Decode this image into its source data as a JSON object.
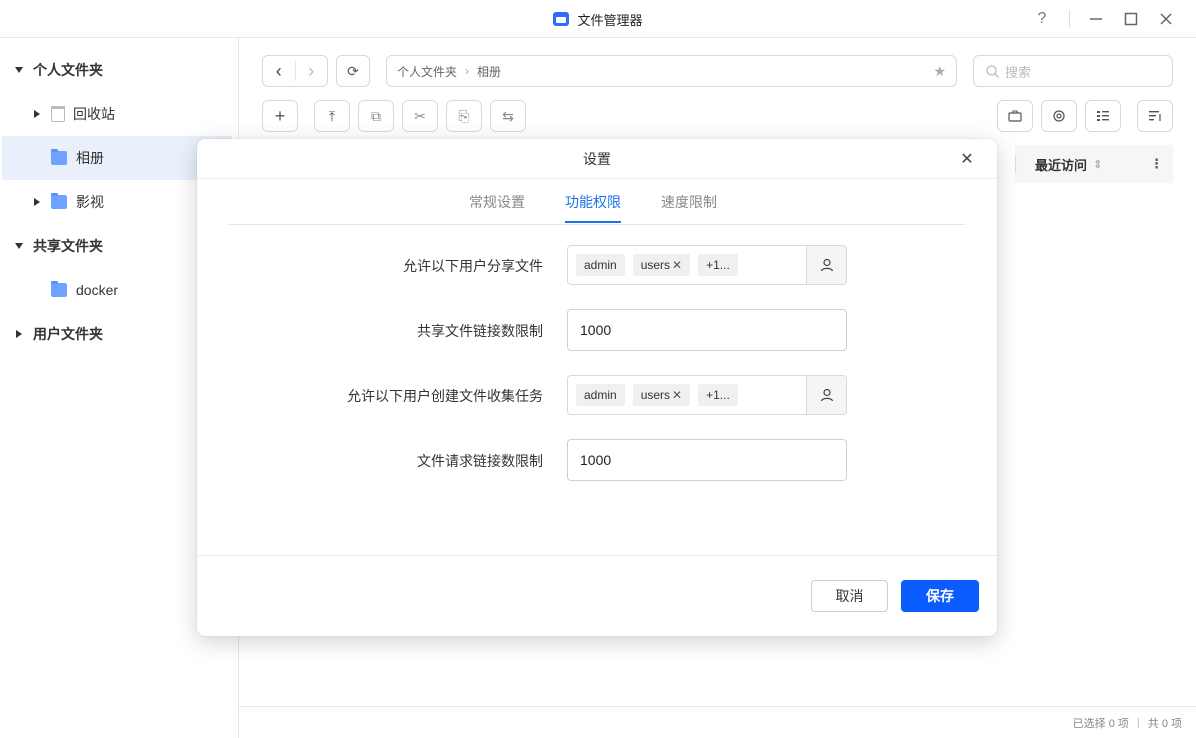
{
  "window": {
    "title": "文件管理器",
    "help": "?",
    "minimize": "—",
    "maximize": "☐",
    "close": "✕"
  },
  "sidebar": {
    "items": [
      {
        "label": "个人文件夹"
      },
      {
        "label": "回收站"
      },
      {
        "label": "相册"
      },
      {
        "label": "影视"
      },
      {
        "label": "共享文件夹"
      },
      {
        "label": "docker"
      },
      {
        "label": "用户文件夹"
      }
    ]
  },
  "toolbar": {
    "back": "‹",
    "forward": "›",
    "refresh": "⟳",
    "breadcrumb": [
      "个人文件夹",
      "相册"
    ],
    "breadcrumb_sep": "›",
    "star": "★",
    "search_placeholder": "搜索",
    "new": "+",
    "upload": "⤒",
    "copy": "⧉",
    "cut": "✂",
    "paste": "⎘",
    "move": "⇆"
  },
  "column": {
    "header": "最近访问",
    "sort": "⇕",
    "more": "⋮"
  },
  "status": {
    "selected": "已选择 0 项",
    "sep": "|",
    "total": "共 0 项"
  },
  "dialog": {
    "title": "设置",
    "close": "✕",
    "tabs": [
      "常规设置",
      "功能权限",
      "速度限制"
    ],
    "active_tab": "功能权限",
    "fields": [
      {
        "label": "允许以下用户分享文件",
        "chips": [
          "admin",
          "users",
          "+1..."
        ]
      },
      {
        "label": "共享文件链接数限制",
        "value": "1000"
      },
      {
        "label": "允许以下用户创建文件收集任务",
        "chips": [
          "admin",
          "users",
          "+1..."
        ]
      },
      {
        "label": "文件请求链接数限制",
        "value": "1000"
      }
    ],
    "chip_close": "✕",
    "cancel": "取消",
    "save": "保存"
  },
  "colors": {
    "accent": "#0a5cff",
    "tab_active": "#1a73e8",
    "selected_row": "#e9effb",
    "folder": "#6fa3ff"
  }
}
